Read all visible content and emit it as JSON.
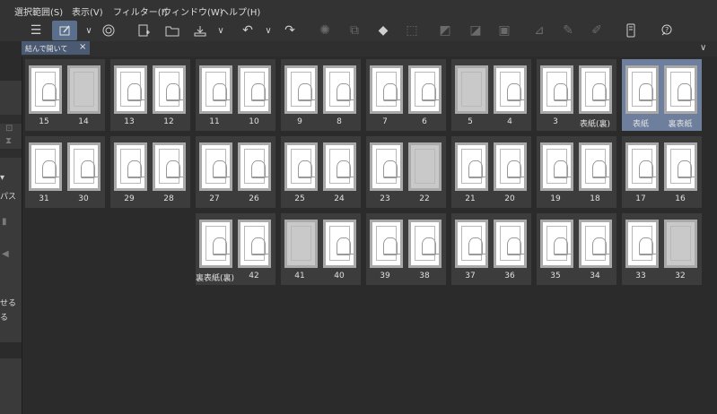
{
  "menu": [
    "選択範囲(S)",
    "表示(V)",
    "フィルター(I)",
    "ウィンドウ(W)",
    "ヘルプ(H)"
  ],
  "tab": {
    "label": "結んで開いて",
    "close": "×"
  },
  "left_panel": {
    "text1": "パス",
    "text2": "せる",
    "text3": "る"
  },
  "pages": {
    "row1": [
      {
        "left": "15",
        "right": "14",
        "lg": false,
        "rg": true
      },
      {
        "left": "13",
        "right": "12",
        "lg": false,
        "rg": false
      },
      {
        "left": "11",
        "right": "10",
        "lg": false,
        "rg": false
      },
      {
        "left": "9",
        "right": "8",
        "lg": false,
        "rg": false
      },
      {
        "left": "7",
        "right": "6",
        "lg": false,
        "rg": false
      },
      {
        "left": "5",
        "right": "4",
        "lg": true,
        "rg": false
      },
      {
        "left": "3",
        "right": "表紙(裏)",
        "lg": false,
        "rg": false
      },
      {
        "left": "表紙",
        "right": "裏表紙",
        "lg": false,
        "rg": false,
        "selected": true
      }
    ],
    "row2": [
      {
        "left": "31",
        "right": "30",
        "lg": false,
        "rg": false
      },
      {
        "left": "29",
        "right": "28",
        "lg": false,
        "rg": false
      },
      {
        "left": "27",
        "right": "26",
        "lg": false,
        "rg": false
      },
      {
        "left": "25",
        "right": "24",
        "lg": false,
        "rg": false
      },
      {
        "left": "23",
        "right": "22",
        "lg": false,
        "rg": true
      },
      {
        "left": "21",
        "right": "20",
        "lg": false,
        "rg": false
      },
      {
        "left": "19",
        "right": "18",
        "lg": false,
        "rg": false
      },
      {
        "left": "17",
        "right": "16",
        "lg": false,
        "rg": false
      }
    ],
    "row3": [
      {
        "left": "裏表紙(裏)",
        "right": "42",
        "lg": false,
        "rg": false
      },
      {
        "left": "41",
        "right": "40",
        "lg": true,
        "rg": false
      },
      {
        "left": "39",
        "right": "38",
        "lg": false,
        "rg": false
      },
      {
        "left": "37",
        "right": "36",
        "lg": false,
        "rg": false
      },
      {
        "left": "35",
        "right": "34",
        "lg": false,
        "rg": false
      },
      {
        "left": "33",
        "right": "32",
        "lg": false,
        "rg": true
      }
    ]
  }
}
